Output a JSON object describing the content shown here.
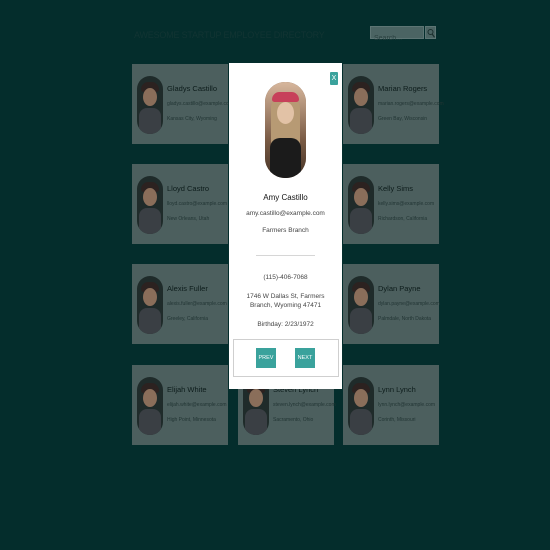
{
  "header": {
    "title": "AWESOME STARTUP EMPLOYEE DIRECTORY",
    "search_placeholder": "Search...",
    "search_icon": "search-icon"
  },
  "employees": [
    {
      "name": "Gladys Castillo",
      "email": "gladys.castillo@example.com",
      "city": "Kansas City, Wyoming"
    },
    {
      "name": "Amy Castillo",
      "email": "amy.castillo@example.com",
      "city": "Farmers Branch"
    },
    {
      "name": "Marian Rogers",
      "email": "marian.rogers@example.com",
      "city": "Green Bay, Wisconsin"
    },
    {
      "name": "Lloyd Castro",
      "email": "lloyd.castro@example.com",
      "city": "New Orleans, Utah"
    },
    {
      "name": "",
      "email": "",
      "city": ""
    },
    {
      "name": "Kelly Sims",
      "email": "kelly.sims@example.com",
      "city": "Richardson, California"
    },
    {
      "name": "Alexis Fuller",
      "email": "alexis.fuller@example.com",
      "city": "Greeley, California"
    },
    {
      "name": "",
      "email": "",
      "city": ""
    },
    {
      "name": "Dylan Payne",
      "email": "dylan.payne@example.com",
      "city": "Palmdale, North Dakota"
    },
    {
      "name": "Elijah White",
      "email": "elijah.white@example.com",
      "city": "High Point, Minnesota"
    },
    {
      "name": "Steven Lynch",
      "email": "steven.lynch@example.com",
      "city": "Sacramento, Ohio"
    },
    {
      "name": "Lynn Lynch",
      "email": "lynn.lynch@example.com",
      "city": "Corinth, Missouri"
    }
  ],
  "modal": {
    "close_label": "X",
    "name": "Amy Castillo",
    "email": "amy.castillo@example.com",
    "city": "Farmers Branch",
    "phone": "(115)-406-7068",
    "address": "1746 W Dallas St, Farmers Branch, Wyoming 47471",
    "birthday": "Birthday: 2/23/1972",
    "prev_label": "PREV",
    "next_label": "NEXT"
  },
  "colors": {
    "background": "#0b4a49",
    "accent": "#3aa29c",
    "card": "#4c5f5e",
    "modal": "#ffffff"
  }
}
